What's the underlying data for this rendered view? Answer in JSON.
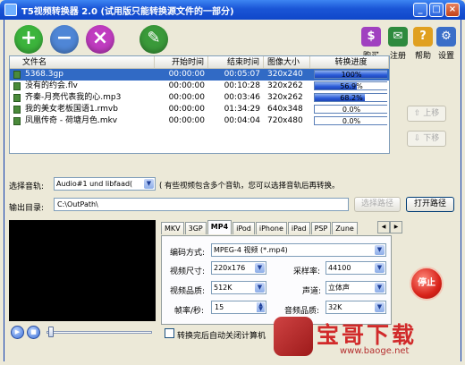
{
  "window": {
    "title": "T5视频转换器 2.0 (试用版只能转换源文件的一部分)",
    "controls": {
      "minimize": "_",
      "maximize": "□",
      "close": "×"
    }
  },
  "toolbar": {
    "left": [
      {
        "label": "添加",
        "icon": "add-icon",
        "glyph": "+",
        "color": "#3cb43c"
      },
      {
        "label": "删除",
        "icon": "remove-icon",
        "glyph": "−",
        "color": "#4f86d6"
      },
      {
        "label": "清空",
        "icon": "clear-icon",
        "glyph": "×",
        "color": "#c03cc0"
      },
      {
        "label": "编辑",
        "icon": "edit-icon",
        "glyph": "✎",
        "color": "#3a9a3a"
      }
    ],
    "right": [
      {
        "label": "购买",
        "icon": "cart-icon",
        "glyph": "$",
        "color": "#a040c0"
      },
      {
        "label": "注册",
        "icon": "register-icon",
        "glyph": "✉",
        "color": "#2e8a3e"
      },
      {
        "label": "帮助",
        "icon": "help-icon",
        "glyph": "?",
        "color": "#e0a020"
      },
      {
        "label": "设置",
        "icon": "settings-icon",
        "glyph": "⚙",
        "color": "#3a6ec8"
      }
    ]
  },
  "filelist": {
    "columns": [
      "文件名",
      "开始时间",
      "结束时间",
      "图像大小",
      "转换进度"
    ],
    "rows": [
      {
        "name": "5368.3gp",
        "start": "00:00:00",
        "end": "00:05:07",
        "size": "320x240",
        "progress": 100,
        "progress_text": "100%",
        "selected": true
      },
      {
        "name": "没有的约会.flv",
        "start": "00:00:00",
        "end": "00:10:28",
        "size": "320x262",
        "progress": 56.9,
        "progress_text": "56.9%",
        "selected": false
      },
      {
        "name": "齐秦-月亮代表我的心.mp3",
        "start": "00:00:00",
        "end": "00:03:46",
        "size": "320x262",
        "progress": 68.2,
        "progress_text": "68.2%",
        "selected": false
      },
      {
        "name": "我的美女老板国语1.rmvb",
        "start": "00:00:00",
        "end": "01:34:29",
        "size": "640x348",
        "progress": 0,
        "progress_text": "0.0%",
        "selected": false
      },
      {
        "name": "凤凰传奇 - 荷塘月色.mkv",
        "start": "00:00:00",
        "end": "00:04:04",
        "size": "720x480",
        "progress": 0,
        "progress_text": "0.0%",
        "selected": false
      }
    ]
  },
  "side": {
    "up": "上移",
    "down": "下移"
  },
  "track": {
    "label": "选择音轨:",
    "value": "Audio#1 und libfaad(",
    "hint": "( 有些视频包含多个音轨，您可以选择音轨后再转换。"
  },
  "output": {
    "label": "输出目录:",
    "value": "C:\\OutPath\\",
    "choose_button": "选择路径",
    "open_button": "打开路径"
  },
  "tabs": [
    "MKV",
    "3GP",
    "MP4",
    "iPod",
    "iPhone",
    "iPad",
    "PSP",
    "Zune"
  ],
  "active_tab": "MP4",
  "settings": {
    "encode": {
      "label": "编码方式:",
      "value": "MPEG-4 视频 (*.mp4)"
    },
    "video_size": {
      "label": "视频尺寸:",
      "value": "220x176"
    },
    "sample_rate": {
      "label": "采样率:",
      "value": "44100"
    },
    "video_quality": {
      "label": "视频品质:",
      "value": "512K"
    },
    "channel": {
      "label": "声道:",
      "value": "立体声"
    },
    "fps": {
      "label": "帧率/秒:",
      "value": "15"
    },
    "audio_quality": {
      "label": "音频品质:",
      "value": "32K"
    }
  },
  "stop_button": "停止",
  "player": {
    "play": "▶",
    "stop": "■"
  },
  "shutdown_checkbox": {
    "label": "转换完后自动关闭计算机",
    "checked": false
  },
  "watermark": {
    "text": "宝哥下载",
    "url": "www.baoge.net"
  }
}
